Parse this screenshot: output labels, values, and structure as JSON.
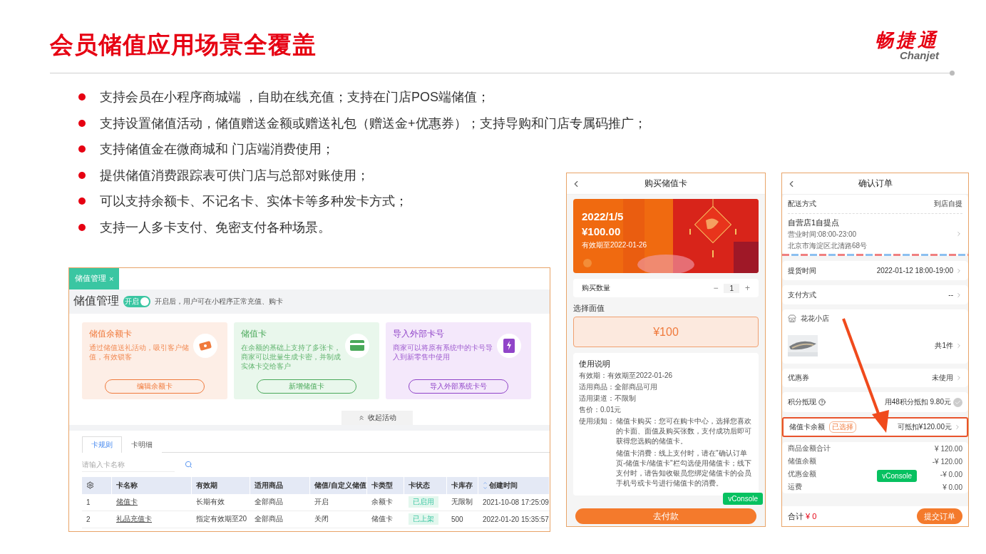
{
  "slide": {
    "title": "会员储值应用场景全覆盖",
    "logo": {
      "name": "畅捷通",
      "latin": "Chanjet"
    }
  },
  "bullets": [
    "支持会员在小程序商城端 ，自助在线充值；支持在门店POS端储值；",
    "支持设置储值活动，储值赠送金额或赠送礼包（赠送金+优惠券）；支持导购和门店专属码推广；",
    "支持储值金在微商城和 门店端消费使用；",
    "提供储值消费跟踪表可供门店与总部对账使用；",
    "可以支持余额卡、不记名卡、实体卡等多种发卡方式；",
    "支持一人多卡支付、免密支付各种场景。"
  ],
  "admin": {
    "tab": {
      "label": "储值管理",
      "close": "×"
    },
    "heading": "储值管理",
    "toggle": {
      "label": "开启",
      "on": true
    },
    "toggle_hint": "开启后，用户可在小程序正常充值、购卡",
    "cards": [
      {
        "kind": "balance",
        "title": "储值余额卡",
        "desc": "通过储值送礼活动，吸引客户储值，有效锁客",
        "button": "编辑余额卡"
      },
      {
        "kind": "card",
        "title": "储值卡",
        "desc": "在余额的基础上支持了多张卡，商家可以批量生成卡密，并制成实体卡交给客户",
        "button": "新增储值卡"
      },
      {
        "kind": "import",
        "title": "导入外部卡号",
        "desc": "商家可以将原有系统中的卡号导入到新零售中使用",
        "button": "导入外部系统卡号"
      }
    ],
    "collapse": "收起活动",
    "tabs": [
      {
        "label": "卡规则",
        "selected": true
      },
      {
        "label": "卡明细",
        "selected": false
      }
    ],
    "search": {
      "placeholder": "请输入卡名称"
    },
    "table": {
      "columns": [
        "卡名称",
        "有效期",
        "适用商品",
        "储值/自定义储值",
        "卡类型",
        "卡状态",
        "卡库存",
        "创建时间"
      ],
      "rows": [
        {
          "index": "1",
          "cells": [
            "储值卡",
            "长期有效",
            "全部商品",
            "开启",
            "余额卡",
            "已启用",
            "无限制",
            "2021-10-08 17:25:09"
          ]
        },
        {
          "index": "2",
          "cells": [
            "礼品充值卡",
            "指定有效期至20",
            "全部商品",
            "关闭",
            "储值卡",
            "已上架",
            "500",
            "2022-01-20 15:35:57"
          ]
        }
      ]
    }
  },
  "phone_buy": {
    "title": "购买储值卡",
    "banner": {
      "date": "2022/1/5",
      "amount": "¥100.00",
      "validity": "有效期至2022-01-26"
    },
    "quantity": {
      "label": "购买数量",
      "minus": "−",
      "value": "1",
      "plus": "+"
    },
    "face_value": {
      "label": "选择面值",
      "options": [
        {
          "label": "¥100",
          "selected": true
        }
      ]
    },
    "instructions": {
      "title": "使用说明",
      "items": [
        {
          "label": "有效期：",
          "value": "有效期至2022-01-26"
        },
        {
          "label": "适用商品：",
          "value": "全部商品可用"
        },
        {
          "label": "适用渠道：",
          "value": "不限制"
        },
        {
          "label": "售价：",
          "value": "0.01元"
        }
      ],
      "notice_label": "使用须知：",
      "notice": [
        "储值卡购买：您可在购卡中心，选择您喜欢的卡面、面值及购买张数，支付成功后即可获得您选购的储值卡。",
        "储值卡消费：线上支付时，请在\"确认订单页-储值卡/储值卡\"栏勾选使用储值卡；线下支付时，请告知收银员您绑定储值卡的会员手机号或卡号进行储值卡的消费。"
      ]
    },
    "pay_button": "去付款",
    "vconsole": "vConsole"
  },
  "phone_order": {
    "title": "确认订单",
    "delivery": {
      "label": "配送方式",
      "value": "到店自提"
    },
    "pickup": {
      "name": "自营店1自提点",
      "hours": "营业时间:08:00-23:00",
      "address": "北京市海淀区北清路68号"
    },
    "rows": [
      {
        "label": "提货时间",
        "value": "2022-01-12 18:00-19:00"
      },
      {
        "label": "支付方式",
        "value": "--"
      }
    ],
    "store": {
      "name": "花花小店",
      "count": "共1件"
    },
    "coupon": {
      "label": "优惠券",
      "value": "未使用"
    },
    "points": {
      "label": "积分抵现",
      "value": "用48积分抵扣 9.80元"
    },
    "balance": {
      "label": "储值卡余额",
      "tag": "已选择",
      "value": "可抵扣¥120.00元",
      "highlighted": true
    },
    "summary": [
      {
        "label": "商品金额合计",
        "value": "¥ 120.00"
      },
      {
        "label": "储值余额",
        "value": "-¥ 120.00"
      },
      {
        "label": "优惠金额",
        "value": "-¥ 0.00"
      },
      {
        "label": "运费",
        "value": "¥ 0.00"
      }
    ],
    "footer": {
      "label": "合计",
      "amount": "¥ 0",
      "button": "提交订单"
    },
    "vconsole": "vConsole"
  }
}
